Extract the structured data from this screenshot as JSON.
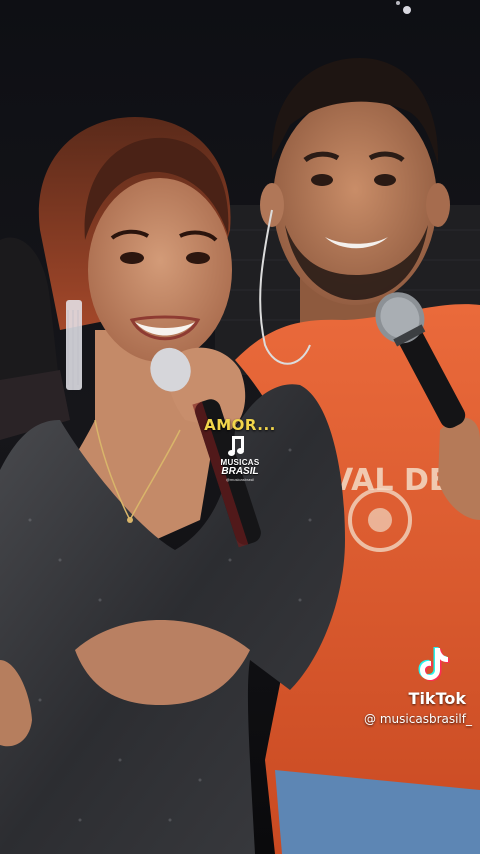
{
  "video": {
    "caption": "AMOR...",
    "shirt_text": "VAL DE"
  },
  "brand_overlay": {
    "line1": "MUSICAS",
    "line2": "BRASIL",
    "line3": "@musicasbrasil",
    "icon": "music-note-icon"
  },
  "watermark": {
    "platform": "TikTok",
    "handle": "@ musicasbrasilf_",
    "icon": "tiktok-logo-icon"
  },
  "colors": {
    "caption": "#f2d64b",
    "shirt": "#e0562a",
    "background": "#0b0b0d"
  }
}
